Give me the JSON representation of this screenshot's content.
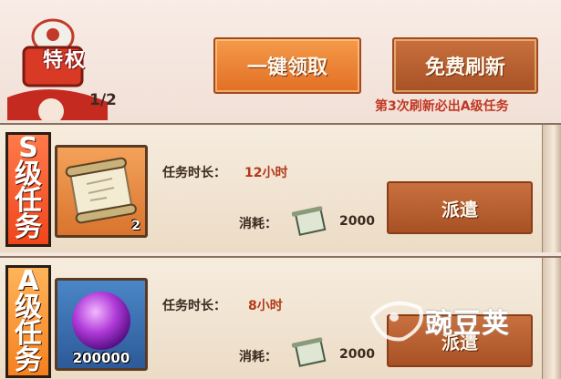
{
  "header": {
    "emblem_label": "特权",
    "count": "1/2",
    "claim_all_label": "一键领取",
    "free_refresh_label": "免费刷新",
    "refresh_hint": "第3次刷新必出A级任务"
  },
  "tasks": [
    {
      "tag": [
        "S",
        "级",
        "任",
        "务"
      ],
      "item_count": "2",
      "duration_label": "任务时长：",
      "duration_value": "12小时",
      "cost_label": "消耗：",
      "cost_value": "2000",
      "dispatch_label": "派遣"
    },
    {
      "tag": [
        "A",
        "级",
        "任",
        "务"
      ],
      "item_count": "200000",
      "duration_label": "任务时长：",
      "duration_value": "8小时",
      "cost_label": "消耗：",
      "cost_value": "2000",
      "dispatch_label": "派遣"
    }
  ],
  "watermark": {
    "text": "豌豆荚"
  },
  "colors": {
    "accent_orange": "#e26f24",
    "button_brown": "#a85125",
    "hint_red": "#c03824"
  },
  "icons": [
    "scroll-icon",
    "purple-orb-icon",
    "small-scroll-icon",
    "pea-logo-icon"
  ]
}
